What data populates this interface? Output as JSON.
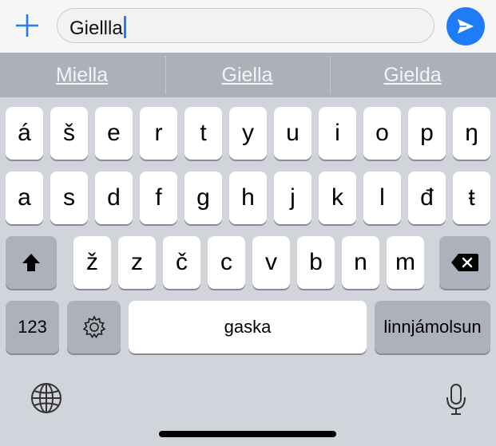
{
  "input": {
    "text": "Giellla"
  },
  "suggestions": [
    "Miella",
    "Giella",
    "Gielda"
  ],
  "rows": [
    [
      "á",
      "š",
      "e",
      "r",
      "t",
      "y",
      "u",
      "i",
      "o",
      "p",
      "ŋ"
    ],
    [
      "a",
      "s",
      "d",
      "f",
      "g",
      "h",
      "j",
      "k",
      "l",
      "đ",
      "ŧ"
    ],
    [
      "ž",
      "z",
      "č",
      "c",
      "v",
      "b",
      "n",
      "m"
    ]
  ],
  "bottom": {
    "numbers": "123",
    "space": "gaska",
    "return": "linnjámolsun"
  },
  "colors": {
    "accent": "#1f7cf7",
    "key": "#ffffff",
    "key_dark": "#acb1bb",
    "suggestion_bar": "#acb0b9"
  },
  "icons": [
    "plus-icon",
    "send-icon",
    "shift-icon",
    "backspace-icon",
    "settings-icon",
    "globe-icon",
    "microphone-icon"
  ]
}
